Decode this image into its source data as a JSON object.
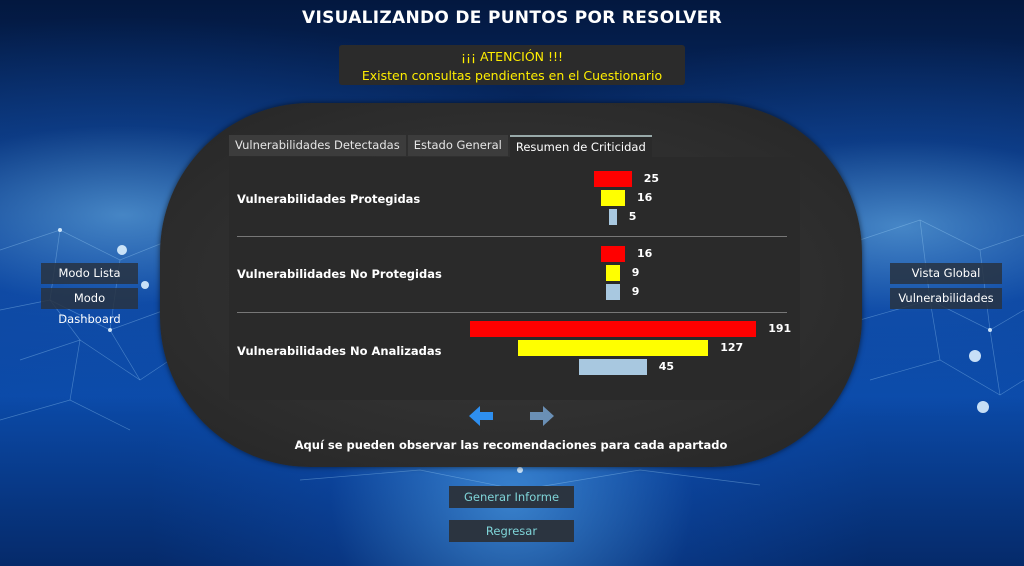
{
  "page": {
    "title": "VISUALIZANDO DE PUNTOS POR RESOLVER",
    "alert": {
      "line1": "¡¡¡ ATENCIÓN !!!",
      "line2": "Existen consultas pendientes en el Cuestionario"
    },
    "caption": "Aquí se pueden observar las recomendaciones para cada apartado"
  },
  "tabs": [
    {
      "label": "Vulnerabilidades Detectadas",
      "active": false
    },
    {
      "label": "Estado General",
      "active": false
    },
    {
      "label": "Resumen de Criticidad",
      "active": true
    }
  ],
  "side_left": {
    "modo_lista": "Modo Lista",
    "modo_dashboard": "Modo Dashboard"
  },
  "side_right": {
    "vista_global": "Vista Global",
    "vulnerabilidades": "Vulnerabilidades"
  },
  "bottom": {
    "generar": "Generar Informe",
    "regresar": "Regresar"
  },
  "colors": {
    "high": "#ff0000",
    "medium": "#ffff00",
    "low": "#a8c8e0",
    "prev_arrow": "#2e8ff0",
    "next_arrow": "#6a8fb5"
  },
  "icons": {
    "prev": "arrow-left-icon",
    "next": "arrow-right-icon"
  },
  "chart_data": {
    "type": "bar",
    "categories": [
      "Vulnerabilidades Protegidas",
      "Vulnerabilidades No Protegidas",
      "Vulnerabilidades No Analizadas"
    ],
    "series": [
      {
        "values": [
          25,
          16,
          191
        ]
      },
      {
        "values": [
          16,
          9,
          127
        ]
      },
      {
        "values": [
          5,
          9,
          45
        ]
      }
    ]
  }
}
